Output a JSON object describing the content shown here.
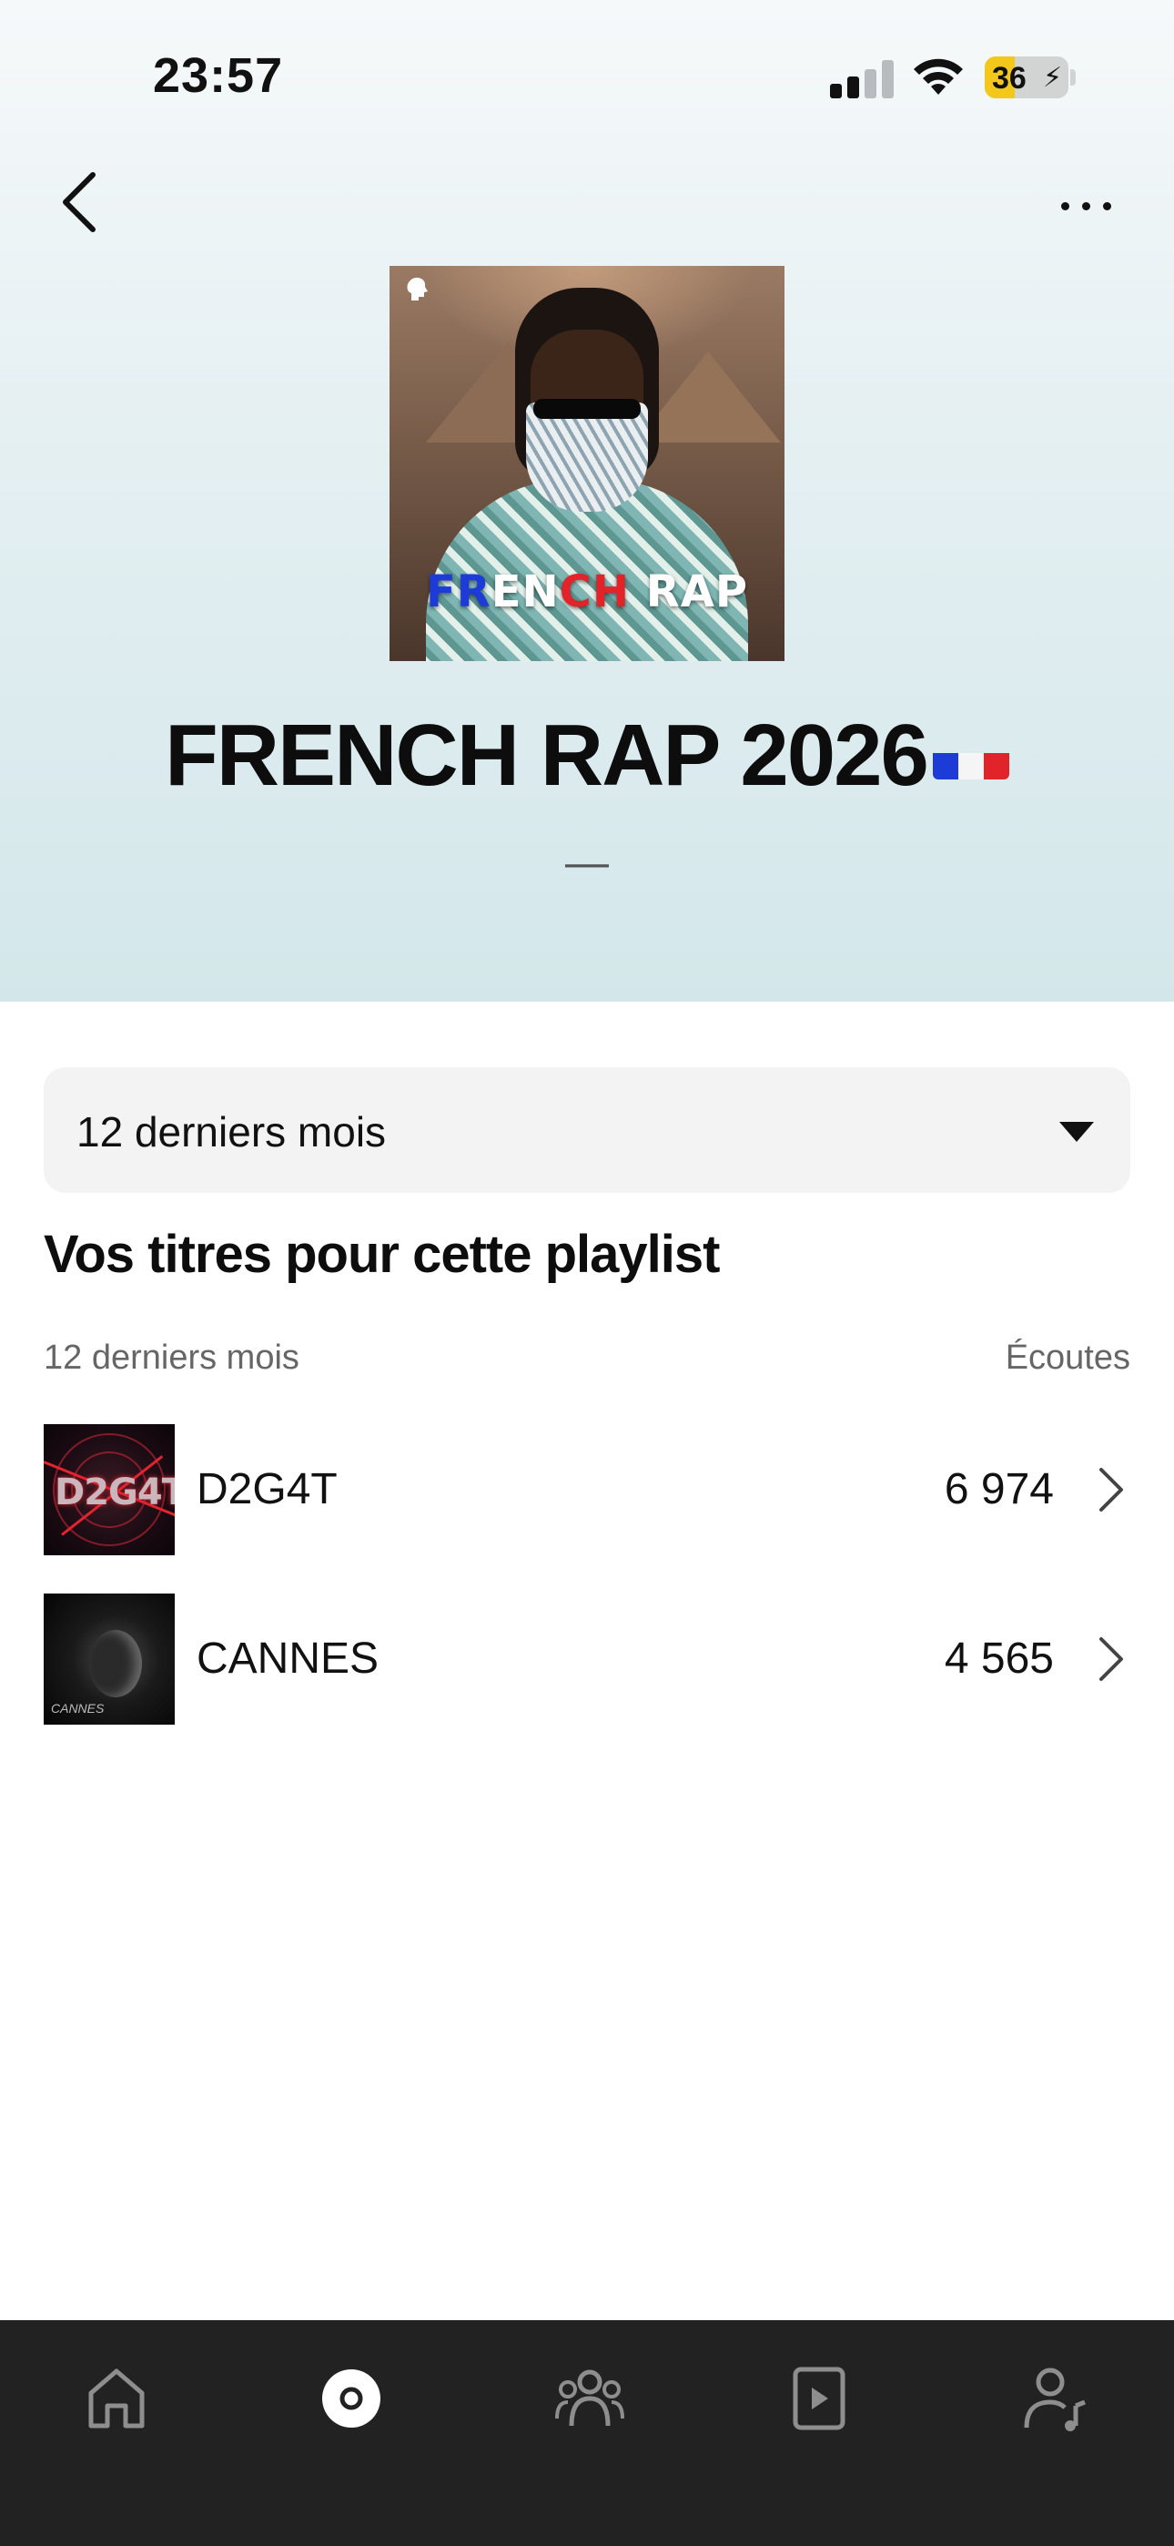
{
  "status_bar": {
    "time": "23:57",
    "battery": "36",
    "battery_level": 0.36
  },
  "header": {
    "back_icon": "chevron-left-icon",
    "more_icon": "ellipsis-icon"
  },
  "cover": {
    "badge_icon": "artist-silhouette-icon",
    "text_part1": "FR",
    "text_part2": "EN",
    "text_part3": "CH",
    "text_part4": " RAP"
  },
  "playlist": {
    "title": "FRENCH RAP 2026",
    "flag": "🇫🇷",
    "subtitle": "—"
  },
  "filter": {
    "selected": "12 derniers mois",
    "caret_icon": "caret-down-icon"
  },
  "section": {
    "title": "Vos titres pour cette playlist",
    "period_label": "12 derniers mois",
    "plays_label": "Écoutes"
  },
  "tracks": [
    {
      "name": "D2G4T",
      "plays": "6 974",
      "art_text": "D2G4T"
    },
    {
      "name": "CANNES",
      "plays": "4 565",
      "art_text": "CANNES"
    }
  ],
  "tabbar": {
    "active_index": 1,
    "tabs": [
      "home-icon",
      "releases-disc-icon",
      "audience-icon",
      "video-icon",
      "profile-music-icon"
    ]
  },
  "colors": {
    "accent_yellow": "#f3c81b",
    "tabbar_bg": "#222222",
    "flag_blue": "#1d3bd6",
    "flag_red": "#e0242a"
  }
}
